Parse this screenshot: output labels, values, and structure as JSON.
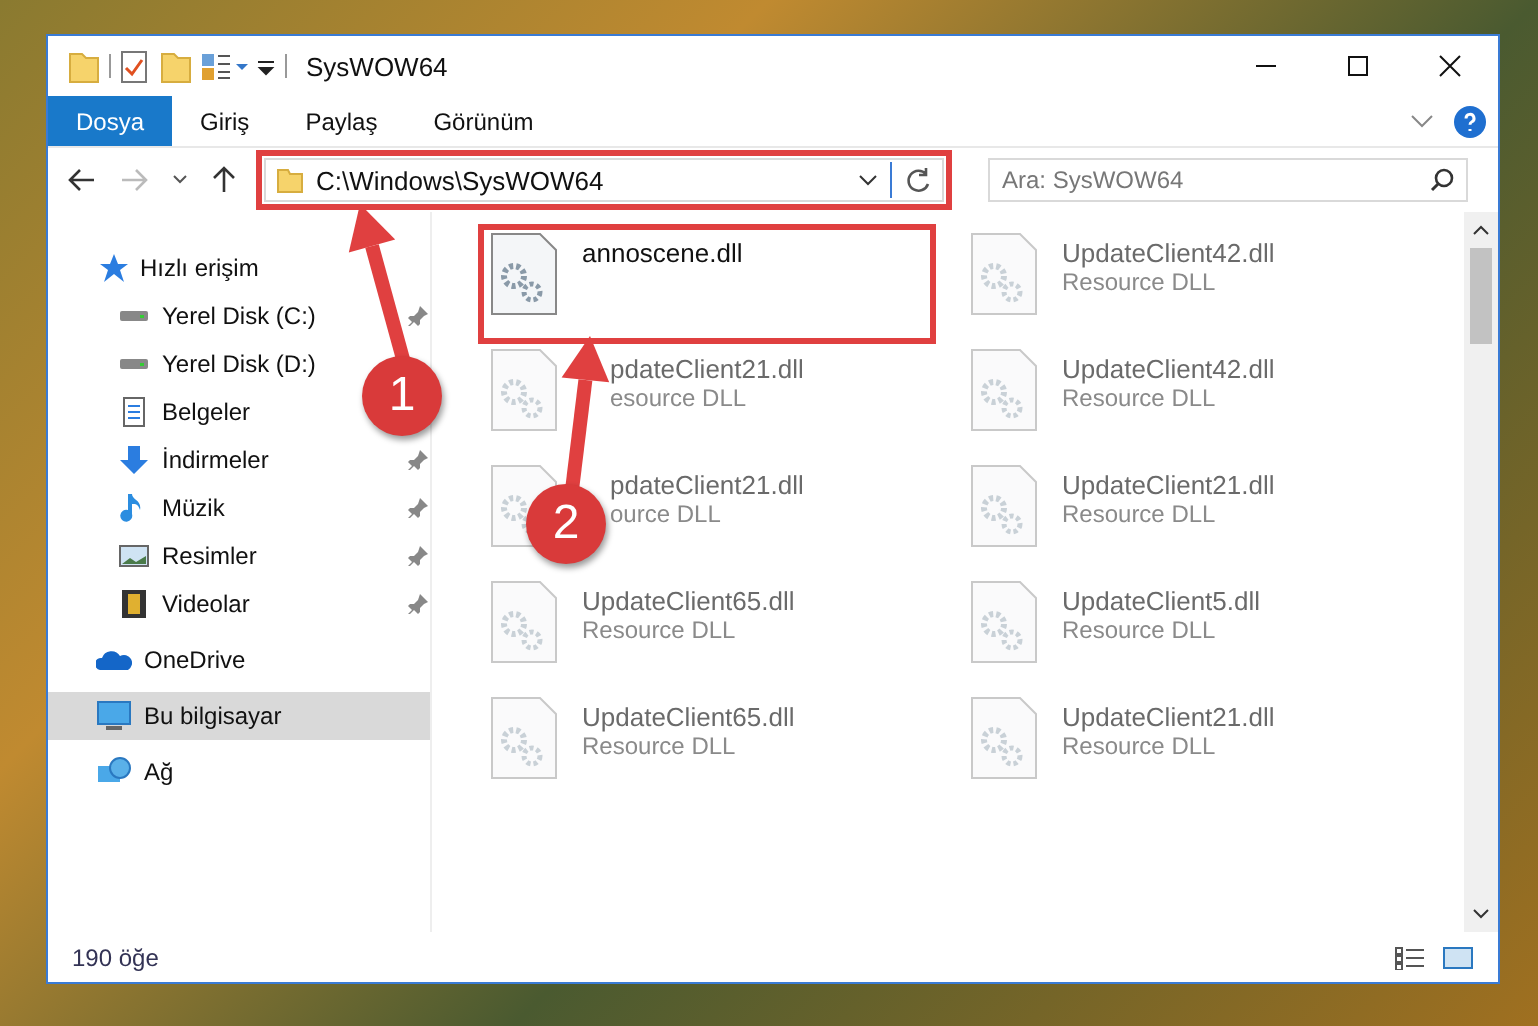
{
  "window": {
    "title": "SysWOW64"
  },
  "ribbon_tabs": [
    {
      "label": "Dosya",
      "selected": true
    },
    {
      "label": "Giriş",
      "selected": false
    },
    {
      "label": "Paylaş",
      "selected": false
    },
    {
      "label": "Görünüm",
      "selected": false
    }
  ],
  "address_bar": {
    "path": "C:\\Windows\\SysWOW64",
    "highlighted": true
  },
  "search": {
    "placeholder": "Ara: SysWOW64"
  },
  "sidebar": {
    "items": [
      {
        "label": "Hızlı erişim",
        "kind": "star",
        "selected": false,
        "children": [
          {
            "label": "Yerel Disk (C:)",
            "kind": "drive",
            "pinned": true
          },
          {
            "label": "Yerel Disk (D:)",
            "kind": "drive",
            "pinned": false
          },
          {
            "label": "Belgeler",
            "kind": "document",
            "pinned": false
          },
          {
            "label": "İndirmeler",
            "kind": "download",
            "pinned": true
          },
          {
            "label": "Müzik",
            "kind": "music",
            "pinned": true
          },
          {
            "label": "Resimler",
            "kind": "picture",
            "pinned": true
          },
          {
            "label": "Videolar",
            "kind": "video",
            "pinned": true
          }
        ]
      },
      {
        "label": "OneDrive",
        "kind": "cloud",
        "selected": false
      },
      {
        "label": "Bu bilgisayar",
        "kind": "computer",
        "selected": true
      },
      {
        "label": "Ağ",
        "kind": "network",
        "selected": false
      }
    ]
  },
  "files": [
    {
      "name": "annoscene.dll",
      "highlighted": true,
      "blurred": false
    },
    {
      "name": "UpdateClient42.dll",
      "type": "Resource DLL",
      "highlighted": false,
      "blurred": true
    },
    {
      "name": "pdateClient21.dll",
      "type": "esource DLL",
      "highlighted": false,
      "blurred": true,
      "covered": true
    },
    {
      "name": "UpdateClient42.dll",
      "type": "Resource DLL",
      "highlighted": false,
      "blurred": true
    },
    {
      "name": "pdateClient21.dll",
      "type": "ource DLL",
      "highlighted": false,
      "blurred": true,
      "covered": true
    },
    {
      "name": "UpdateClient21.dll",
      "type": "Resource DLL",
      "highlighted": false,
      "blurred": true
    },
    {
      "name": "UpdateClient65.dll",
      "type": "Resource DLL",
      "highlighted": false,
      "blurred": true
    },
    {
      "name": "UpdateClient5.dll",
      "type": "Resource DLL",
      "highlighted": false,
      "blurred": true
    },
    {
      "name": "UpdateClient65.dll",
      "type": "Resource DLL",
      "highlighted": false,
      "blurred": true
    },
    {
      "name": "UpdateClient21.dll",
      "type": "Resource DLL",
      "highlighted": false,
      "blurred": true
    }
  ],
  "status_bar": {
    "count": "190 öğe"
  },
  "annotations": [
    {
      "number": "1"
    },
    {
      "number": "2"
    }
  ]
}
